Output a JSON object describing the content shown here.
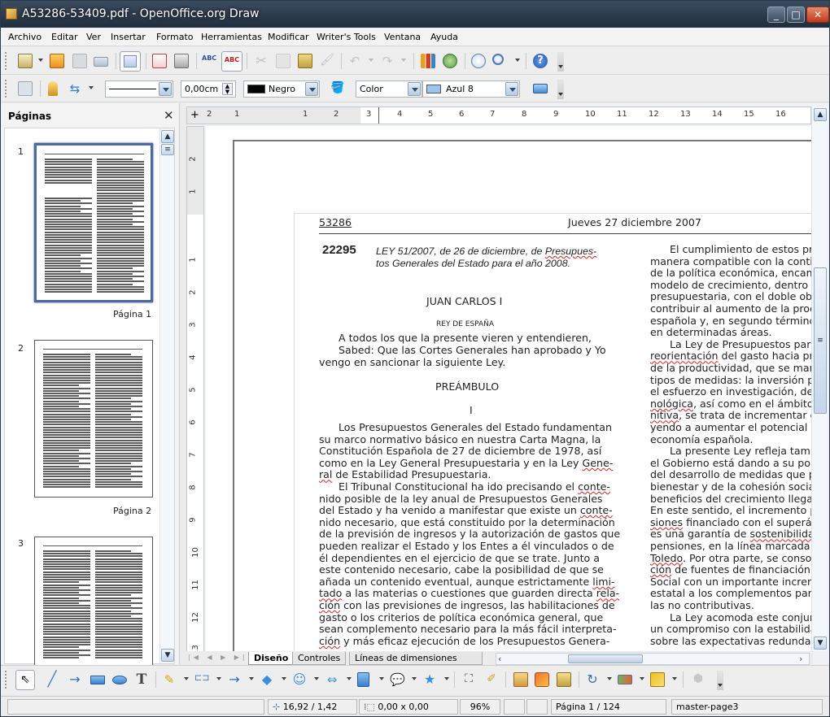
{
  "window": {
    "title": "A53286-53409.pdf - OpenOffice.org Draw",
    "minimize": "_",
    "maximize": "□",
    "close": "✕"
  },
  "menu": [
    "Archivo",
    "Editar",
    "Ver",
    "Insertar",
    "Formato",
    "Herramientas",
    "Modificar",
    "Writer's Tools",
    "Ventana",
    "Ayuda"
  ],
  "toolbar2": {
    "line_width": "0,00cm",
    "line_color": "Negro",
    "area_style": "Color",
    "area_color": "Azul 8",
    "line_color_swatch": "#000000",
    "area_color_swatch": "#9cc4ee"
  },
  "sidebar": {
    "title": "Páginas",
    "close": "✕",
    "pages": [
      {
        "num": "1",
        "label": "Página 1"
      },
      {
        "num": "2",
        "label": "Página 2"
      },
      {
        "num": "3",
        "label": ""
      }
    ]
  },
  "ruler": {
    "h_ticks": [
      "2",
      "1",
      "1",
      "2",
      "3",
      "4",
      "5",
      "6",
      "7",
      "8",
      "9",
      "10",
      "11",
      "12",
      "13",
      "14",
      "15",
      "16"
    ],
    "v_ticks": [
      "2",
      "1",
      "1",
      "2",
      "3",
      "4",
      "5",
      "6",
      "7",
      "8",
      "9",
      "10",
      "11",
      "12",
      "13"
    ]
  },
  "document": {
    "page_number": "53286",
    "date": "Jueves 27 diciembre 2007",
    "law_number": "22295",
    "law_title_1": "LEY 51/2007, de 26 de diciembre, de ",
    "law_title_1_sq": "Presupues-",
    "law_title_2": "tos Generales del Estado para el año 2008.",
    "king": "JUAN CARLOS I",
    "king_sub": "REY DE ESPAÑA",
    "intro": [
      "A todos los que la presente vieren y entendieren,",
      "Sabed: Que las Cortes Generales han aprobado y Yo",
      "vengo en sancionar la siguiente Ley."
    ],
    "preamble": "PREÁMBULO",
    "section": "I",
    "left_col": [
      {
        "text": "Los Presupuestos Generales del Estado fundamentan",
        "indent": true
      },
      {
        "text": "su marco normativo básico en nuestra Carta Magna, la"
      },
      {
        "text": "Constitución Española de 27 de diciembre de 1978, así"
      },
      {
        "text": "como en la Ley General Presupuestaria y en la Ley ",
        "sq": "Gene-"
      },
      {
        "text": "",
        "sq": "ral",
        "after": " de Estabilidad Presupuestaria."
      },
      {
        "text": "El Tribunal Constitucional ha ido precisando el ",
        "sq": "conte-",
        "indent": true
      },
      {
        "text": "nido posible de la ley anual de Presupuestos Generales"
      },
      {
        "text": "del Estado y ha venido a manifestar que existe un ",
        "sq": "conte-"
      },
      {
        "text": "nido necesario, que está constituido por la determinación"
      },
      {
        "text": "de la previsión de ingresos y la autorización de gastos que"
      },
      {
        "text": "pueden realizar el Estado y los Entes a él vinculados o de"
      },
      {
        "text": "él dependientes en el ejercicio de que se trate. Junto a"
      },
      {
        "text": "este contenido necesario, cabe la posibilidad de que se"
      },
      {
        "text": "añada un contenido eventual, aunque estrictamente ",
        "sq": "limi-"
      },
      {
        "text": "",
        "sq": "tado",
        "after": " a las materias o cuestiones que guarden directa ",
        "sq2": "rela-"
      },
      {
        "text": "",
        "sq": "ción",
        "after": " con las previsiones de ingresos, las habilitaciones de"
      },
      {
        "text": "gasto o los criterios de política económica general, que"
      },
      {
        "text": "sean complemento necesario para la más fácil interpreta-"
      },
      {
        "text": "",
        "sq": "ción",
        "after": " y más eficaz ejecución de los Presupuestos Genera-"
      }
    ],
    "right_col": [
      {
        "text": "El cumplimiento de estos pri",
        "indent": true
      },
      {
        "text": "manera compatible con la conti"
      },
      {
        "text": "de la política económica, encam"
      },
      {
        "text": "modelo de crecimiento, dentro d"
      },
      {
        "text": "presupuestaria, con el doble ob"
      },
      {
        "text": "contribuir al aumento de la proc"
      },
      {
        "text": "española y, en segundo términc"
      },
      {
        "text": "en determinadas áreas."
      },
      {
        "text": "La Ley de Presupuestos para",
        "indent": true
      },
      {
        "text": "",
        "sq": "reorientación",
        "after": " del gasto hacia pr"
      },
      {
        "text": "de la productividad, que se mar"
      },
      {
        "text": "tipos de medidas: la inversión p"
      },
      {
        "text": "el esfuerzo en investigación, de"
      },
      {
        "text": "",
        "sq": "nológica",
        "after": ", así como en el ámbito"
      },
      {
        "text": "",
        "sq": "nitiva",
        "after": ", se trata de incrementar e"
      },
      {
        "text": "yendo a aumentar el potencial d"
      },
      {
        "text": "economía española."
      },
      {
        "text": "La presente Ley refleja tamb",
        "indent": true
      },
      {
        "text": "el Gobierno está dando a su pol"
      },
      {
        "text": "del desarrollo de medidas que p"
      },
      {
        "text": "bienestar y de la cohesión socia"
      },
      {
        "text": "beneficios del crecimiento llega"
      },
      {
        "text": "En este sentido, el incremento p"
      },
      {
        "text": "",
        "sq": "siones",
        "after": " financiado con el superá"
      },
      {
        "text": "es una garantía de ",
        "sq": "sostenibilida"
      },
      {
        "text": "pensiones, en la línea marcada"
      },
      {
        "text": "",
        "sq": "Toledo",
        "after": ". Por otra parte, se conso"
      },
      {
        "text": "",
        "sq": "ción",
        "after": " de fuentes de financiación"
      },
      {
        "text": "Social con un importante incren"
      },
      {
        "text": "estatal a los complementos par"
      },
      {
        "text": "las no contributivas."
      },
      {
        "text": "La Ley acomoda este conjun",
        "indent": true
      },
      {
        "text": "un compromiso con la estabilida"
      },
      {
        "text": "sobre las expectativas redunda"
      }
    ]
  },
  "layer_tabs": [
    "Diseño",
    "Controles",
    "Líneas de dimensiones"
  ],
  "status": {
    "position": "16,92 / 1,42",
    "size": "0,00 x 0,00",
    "zoom": "96%",
    "page": "Página 1 / 124",
    "master": "master-page3"
  },
  "icons": {
    "toolbar1": [
      "new-icon",
      "open-icon",
      "save-icon",
      "email-icon",
      "edit-file-icon",
      "export-pdf-icon",
      "print-icon",
      "spellcheck-icon",
      "autospellcheck-icon",
      "cut-icon",
      "copy-icon",
      "paste-icon",
      "clone-format-icon",
      "undo-icon",
      "redo-icon",
      "chart-icon",
      "gallery-icon",
      "navigator-icon",
      "zoom-icon",
      "help-icon"
    ],
    "drawing": [
      "select-icon",
      "line-icon",
      "arrow-icon",
      "rectangle-icon",
      "ellipse-icon",
      "text-icon",
      "curve-icon",
      "connector-icon",
      "lines-arrows-icon",
      "basic-shapes-icon",
      "symbol-shapes-icon",
      "block-arrows-icon",
      "flowchart-icon",
      "callouts-icon",
      "stars-icon",
      "points-icon",
      "glue-points-icon",
      "fontwork-icon",
      "from-file-icon",
      "gallery-icon",
      "rotate-icon",
      "align-icon",
      "arrange-icon",
      "extrusion-icon"
    ]
  }
}
